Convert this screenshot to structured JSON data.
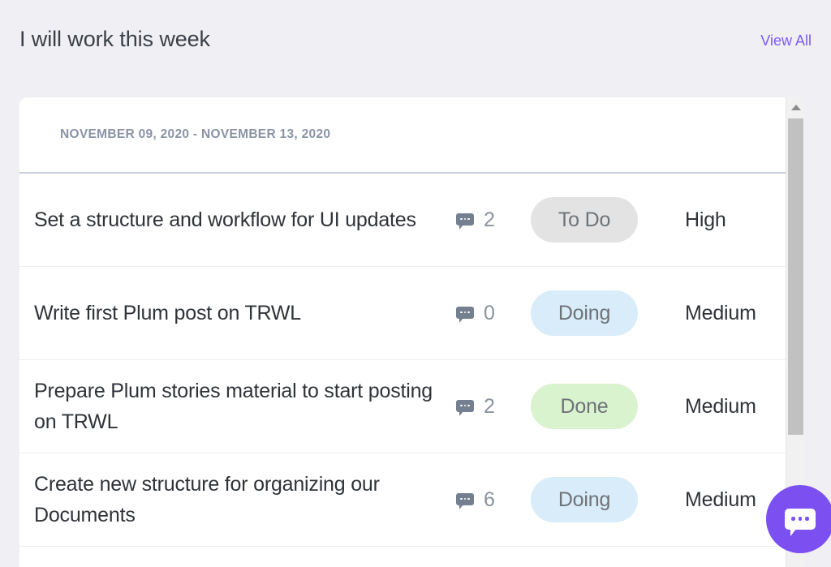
{
  "header": {
    "title": "I will work this week",
    "view_all_label": "View All",
    "link_color": "#7c5cfa"
  },
  "card": {
    "date_group_label": "NOVEMBER 09, 2020 - NOVEMBER 13, 2020",
    "rows": [
      {
        "title": "Set a structure and workflow for UI updates",
        "comment_count": "2",
        "status": "To Do",
        "status_bg": "#e3e3e3",
        "priority": "High"
      },
      {
        "title": "Write first Plum post on TRWL",
        "comment_count": "0",
        "status": "Doing",
        "status_bg": "#d8ecf9",
        "priority": "Medium"
      },
      {
        "title": "Prepare Plum stories material to start posting on TRWL",
        "comment_count": "2",
        "status": "Done",
        "status_bg": "#d9f3cf",
        "priority": "Medium"
      },
      {
        "title": "Create new structure for organizing our Documents",
        "comment_count": "6",
        "status": "Doing",
        "status_bg": "#d8ecf9",
        "priority": "Medium"
      }
    ]
  },
  "scrollbar": {
    "up_arrow_icon": "chevron-up-icon"
  },
  "chat_widget": {
    "icon": "chat-bubble-icon",
    "color": "#7c4ff0"
  }
}
